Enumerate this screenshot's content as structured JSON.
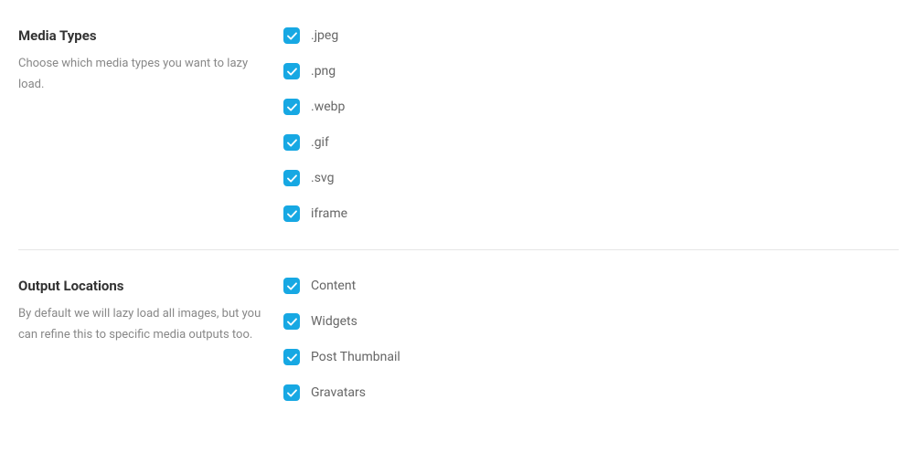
{
  "sections": {
    "media_types": {
      "title": "Media Types",
      "description": "Choose which media types you want to lazy load.",
      "options": [
        {
          "label": ".jpeg",
          "checked": true
        },
        {
          "label": ".png",
          "checked": true
        },
        {
          "label": ".webp",
          "checked": true
        },
        {
          "label": ".gif",
          "checked": true
        },
        {
          "label": ".svg",
          "checked": true
        },
        {
          "label": "iframe",
          "checked": true
        }
      ]
    },
    "output_locations": {
      "title": "Output Locations",
      "description": "By default we will lazy load all images, but you can refine this to specific media outputs too.",
      "options": [
        {
          "label": "Content",
          "checked": true
        },
        {
          "label": "Widgets",
          "checked": true
        },
        {
          "label": "Post Thumbnail",
          "checked": true
        },
        {
          "label": "Gravatars",
          "checked": true
        }
      ]
    }
  }
}
